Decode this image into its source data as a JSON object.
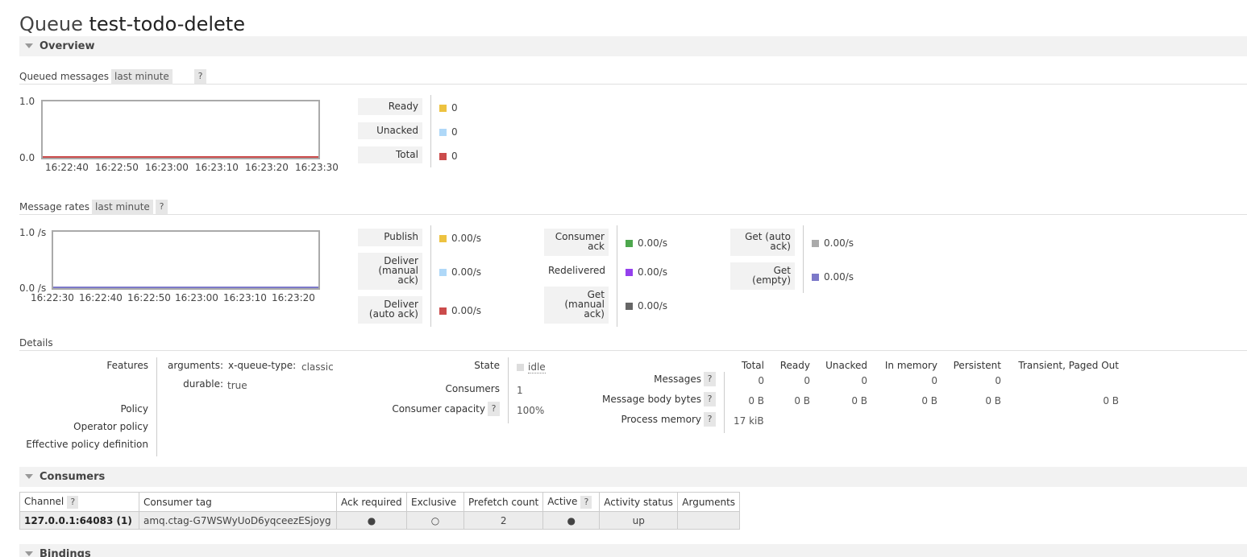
{
  "page": {
    "title_prefix": "Queue",
    "queue_name": "test-todo-delete"
  },
  "overview": {
    "header": "Overview",
    "queued_messages": {
      "label": "Queued messages",
      "range": "last minute",
      "help": "?",
      "y_top": "1.0",
      "y_bottom": "0.0",
      "x_ticks": [
        "16:22:40",
        "16:22:50",
        "16:23:00",
        "16:23:10",
        "16:23:20",
        "16:23:30"
      ],
      "legend": [
        {
          "label": "Ready",
          "value": "0",
          "color": "#edc240"
        },
        {
          "label": "Unacked",
          "value": "0",
          "color": "#afd8f8"
        },
        {
          "label": "Total",
          "value": "0",
          "color": "#cb4b4b"
        }
      ]
    },
    "message_rates": {
      "label": "Message rates",
      "range": "last minute",
      "help": "?",
      "y_top": "1.0 /s",
      "y_bottom": "0.0 /s",
      "x_ticks": [
        "16:22:30",
        "16:22:40",
        "16:22:50",
        "16:23:00",
        "16:23:10",
        "16:23:20"
      ],
      "legend_col1": [
        {
          "label": "Publish",
          "value": "0.00/s",
          "color": "#edc240"
        },
        {
          "label": "Deliver (manual ack)",
          "value": "0.00/s",
          "color": "#afd8f8"
        },
        {
          "label": "Deliver (auto ack)",
          "value": "0.00/s",
          "color": "#cb4b4b"
        }
      ],
      "legend_col2": [
        {
          "label": "Consumer ack",
          "value": "0.00/s",
          "color": "#4da74d"
        },
        {
          "label": "Redelivered",
          "value": "0.00/s",
          "color": "#9440ed"
        },
        {
          "label": "Get (manual ack)",
          "value": "0.00/s",
          "color": "#666666"
        }
      ],
      "legend_col3": [
        {
          "label": "Get (auto ack)",
          "value": "0.00/s",
          "color": "#aaaaaa"
        },
        {
          "label": "Get (empty)",
          "value": "0.00/s",
          "color": "#7c79c9"
        }
      ]
    }
  },
  "details": {
    "label": "Details",
    "features_label": "Features",
    "arguments_label": "arguments:",
    "queue_type_key": "x-queue-type:",
    "queue_type_value": "classic",
    "durable_label": "durable:",
    "durable_value": "true",
    "policy_label": "Policy",
    "operator_policy_label": "Operator policy",
    "effective_policy_label": "Effective policy definition",
    "state_label": "State",
    "state_value": "idle",
    "consumers_label": "Consumers",
    "consumers_value": "1",
    "consumer_capacity_label": "Consumer capacity",
    "consumer_capacity_value": "100%",
    "help": "?",
    "stats_columns": [
      "Total",
      "Ready",
      "Unacked",
      "In memory",
      "Persistent",
      "Transient, Paged Out"
    ],
    "messages_label": "Messages",
    "messages_values": [
      "0",
      "0",
      "0",
      "0",
      "0"
    ],
    "body_bytes_label": "Message body bytes",
    "body_bytes_values": [
      "0 B",
      "0 B",
      "0 B",
      "0 B",
      "0 B",
      "0 B"
    ],
    "process_memory_label": "Process memory",
    "process_memory_value": "17 kiB"
  },
  "consumers": {
    "header": "Consumers",
    "columns": [
      "Channel",
      "Consumer tag",
      "Ack required",
      "Exclusive",
      "Prefetch count",
      "Active",
      "Activity status",
      "Arguments"
    ],
    "help": "?",
    "rows": [
      {
        "channel": "127.0.0.1:64083 (1)",
        "consumer_tag": "amq.ctag-G7WSWyUoD6yqceezESjoyg",
        "ack_required": "●",
        "exclusive": "○",
        "prefetch_count": "2",
        "active": "●",
        "activity_status": "up",
        "arguments": ""
      }
    ]
  },
  "bindings": {
    "header": "Bindings"
  }
}
